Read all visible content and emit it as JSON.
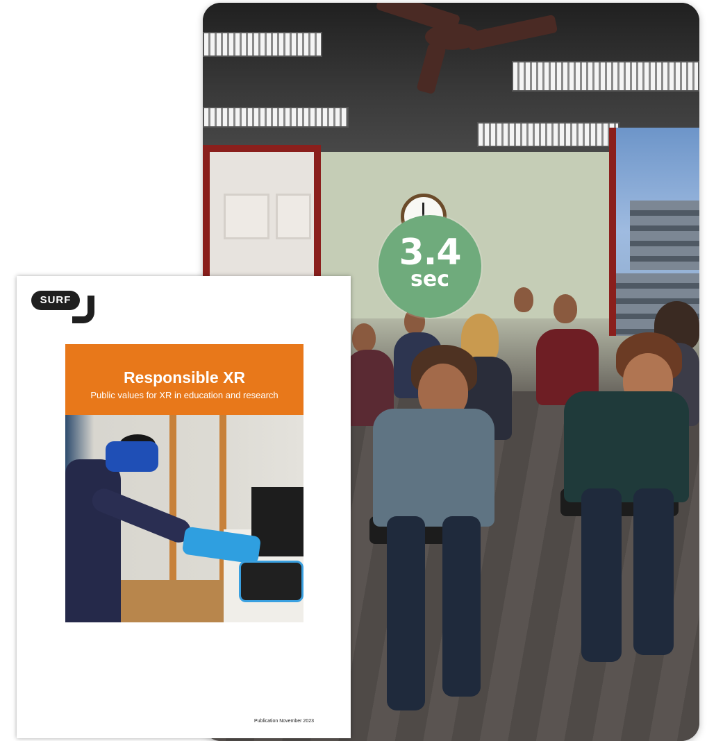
{
  "scene": {
    "timer_value": "3.4",
    "timer_unit": "sec",
    "timer_color": "#6fab7c"
  },
  "cover": {
    "logo_text": "SURF",
    "title": "Responsible XR",
    "subtitle": "Public values for XR in education and research",
    "publication": "Publication November 2023",
    "banner_color": "#e8781a"
  }
}
